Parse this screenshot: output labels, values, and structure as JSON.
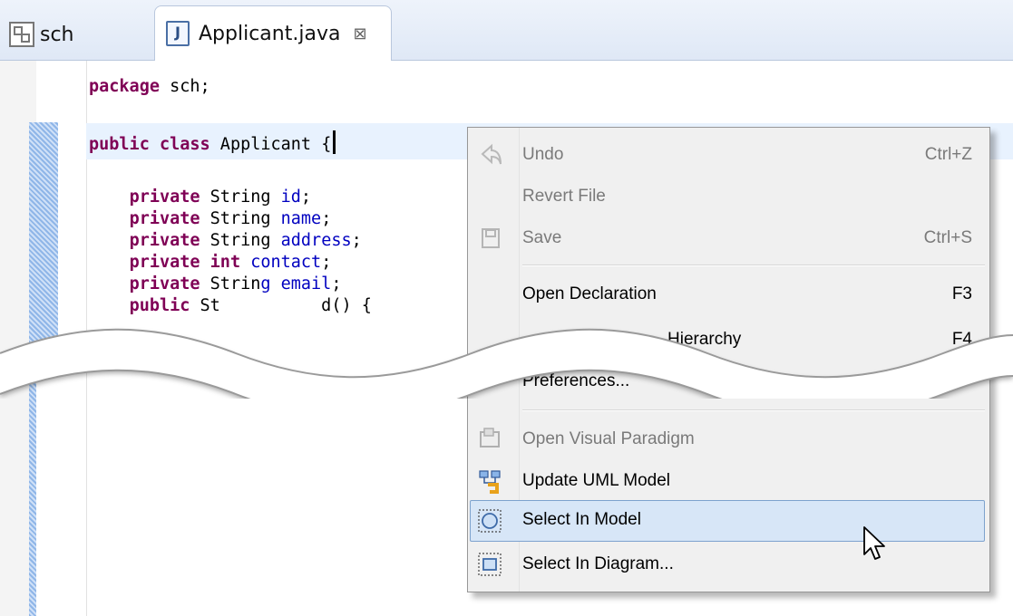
{
  "tabs": [
    {
      "label": "sch",
      "icon": "package-explorer-icon"
    },
    {
      "label": "Applicant.java",
      "icon": "java-file-icon",
      "close_glyph": "⊠"
    }
  ],
  "editor": {
    "line1": {
      "kw": "package",
      "rest": " sch;"
    },
    "line2": {
      "kw1": "public",
      "kw2": "class",
      "rest": " Applicant {"
    },
    "fields": [
      {
        "kw": "private",
        "type": " String ",
        "name": "id",
        "end": ";"
      },
      {
        "kw": "private",
        "type": " String ",
        "name": "name",
        "end": ";"
      },
      {
        "kw": "private",
        "type": " String ",
        "name": "address",
        "end": ";"
      },
      {
        "kw": "private",
        "kw2": "int",
        "name": "contact",
        "end": ";"
      },
      {
        "kw": "private",
        "type": " Strin",
        "name": "g email",
        "end": ";"
      }
    ],
    "line_cut": {
      "kw": "public",
      "rest": " St          d() {"
    }
  },
  "context_menu": {
    "items": [
      {
        "label": "Undo",
        "accel": "Ctrl+Z",
        "enabled": false,
        "icon": "undo-icon"
      },
      {
        "label": "Revert File",
        "accel": "",
        "enabled": false,
        "icon": ""
      },
      {
        "label": "Save",
        "accel": "Ctrl+S",
        "enabled": false,
        "icon": "save-icon"
      },
      {
        "label": "Open Declaration",
        "accel": "F3",
        "enabled": true,
        "icon": ""
      },
      {
        "label": "Open Type Hierarchy",
        "visible_text": "Hierarchy",
        "accel": "F4",
        "enabled": true,
        "icon": ""
      },
      {
        "label": "Preferences...",
        "enabled": true,
        "icon": ""
      },
      {
        "label": "Open Visual Paradigm",
        "enabled": false,
        "icon": "visual-paradigm-icon"
      },
      {
        "label": "Update UML Model",
        "enabled": true,
        "icon": "update-uml-icon"
      },
      {
        "label": "Select In Model",
        "enabled": true,
        "icon": "select-in-model-icon",
        "highlighted": true
      },
      {
        "label": "Select In Diagram...",
        "enabled": true,
        "icon": "select-in-diagram-icon"
      }
    ]
  },
  "colors": {
    "keyword": "#7f0055",
    "field": "#0000c0",
    "highlight": "#d7e6f7"
  }
}
